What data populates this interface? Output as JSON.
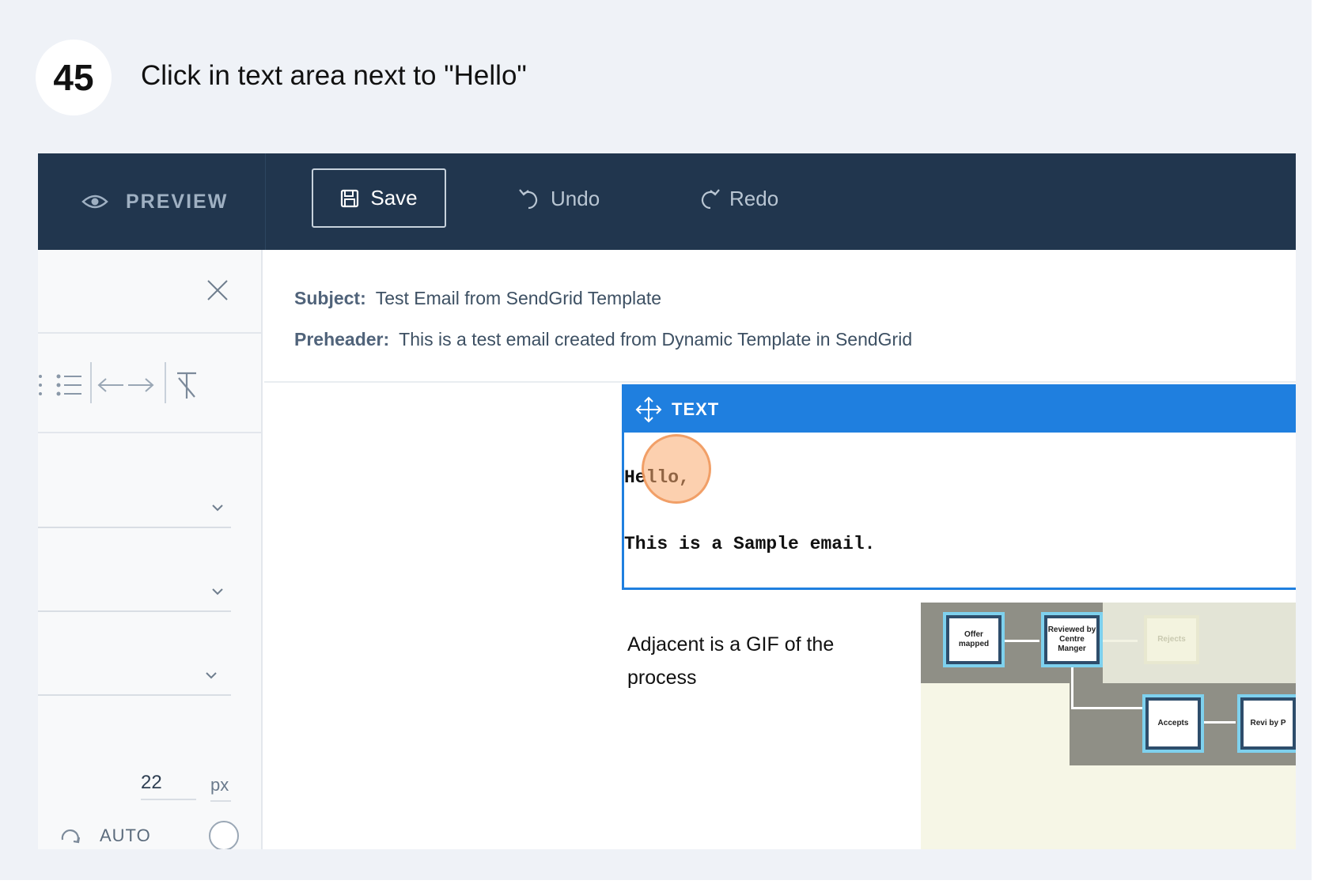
{
  "step": {
    "number": "45",
    "instruction": "Click in text area next to \"Hello\""
  },
  "toolbar": {
    "preview_label": "PREVIEW",
    "save_label": "Save",
    "undo_label": "Undo",
    "redo_label": "Redo"
  },
  "left_panel": {
    "size_value": "22",
    "size_unit": "px",
    "auto_label": "AUTO"
  },
  "email": {
    "subject_key": "Subject:",
    "subject_value": "Test Email from SendGrid Template",
    "preheader_key": "Preheader:",
    "preheader_value": "This is a test email created from Dynamic Template in SendGrid"
  },
  "text_block": {
    "header_label": "TEXT",
    "line1": "Hello,",
    "line2": "This is a Sample email."
  },
  "adjacent_text": "Adjacent is a GIF of the process",
  "gif": {
    "nodes": [
      "Offer mapped",
      "Reviewed by Centre Manger",
      "Rejects",
      "Accepts",
      "Revi by P"
    ]
  },
  "colors": {
    "topbar": "#21364e",
    "block_accent": "#1f7fdf",
    "click_marker": "#faa96e"
  }
}
